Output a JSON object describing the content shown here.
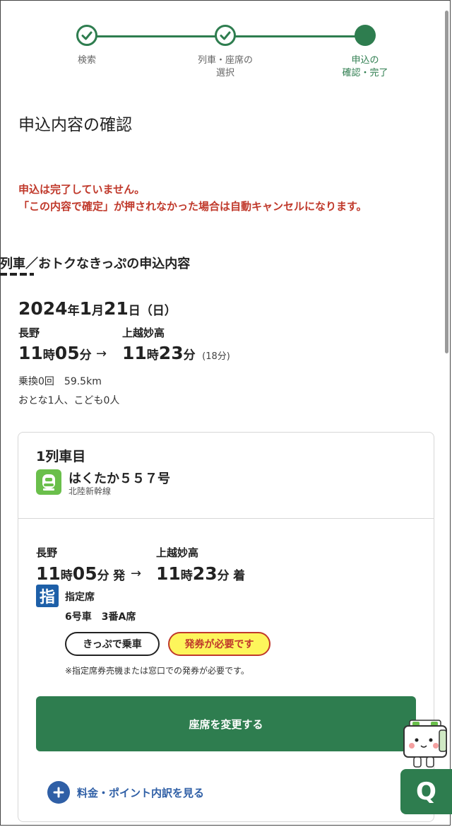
{
  "stepper": {
    "steps": [
      {
        "label_line1": "検索",
        "label_line2": "",
        "status": "done"
      },
      {
        "label_line1": "列車・座席の",
        "label_line2": "選択",
        "status": "done"
      },
      {
        "label_line1": "申込の",
        "label_line2": "確認・完了",
        "status": "current"
      }
    ],
    "accent_color": "#2e7d4f"
  },
  "page_title": "申込内容の確認",
  "warning": {
    "line1": "申込は完了していません。",
    "line2": "「この内容で確定」が押されなかった場合は自動キャンセルになります。",
    "color": "#c0392b"
  },
  "section_title": "列車／おトクなきっぷの申込内容",
  "trip": {
    "date": {
      "year": "2024",
      "year_unit": "年",
      "month": "1",
      "month_unit": "月",
      "day": "21",
      "day_unit": "日",
      "weekday": "（日）"
    },
    "from": "長野",
    "to": "上越妙高",
    "dep": {
      "hour": "11",
      "hour_unit": "時",
      "min": "05",
      "min_unit": "分"
    },
    "arr": {
      "hour": "11",
      "hour_unit": "時",
      "min": "23",
      "min_unit": "分"
    },
    "arrow": "→",
    "duration": "(18分)",
    "transfers": "乗換0回",
    "distance": "59.5km",
    "passengers": "おとな1人、こども0人"
  },
  "train_card": {
    "heading": "1列車目",
    "train_name": "はくたか５５７号",
    "line_name": "北陸新幹線",
    "from": "長野",
    "to": "上越妙高",
    "dep": {
      "hour": "11",
      "hour_unit": "時",
      "min": "05",
      "min_unit": "分",
      "suffix": "発"
    },
    "arr": {
      "hour": "11",
      "hour_unit": "時",
      "min": "23",
      "min_unit": "分",
      "suffix": "着"
    },
    "arrow": "→",
    "seat_badge": "指",
    "seat_type": "指定席",
    "car": "6号車",
    "seat": "3番A席",
    "ticket_pill": "きっぷで乗車",
    "issue_pill": "発券が必要です",
    "note": "※指定席券売機または窓口での発券が必要です。",
    "change_button": "座席を変更する",
    "fare_link": "料金・ポイント内訳を見る"
  },
  "fab": {
    "label": "Q"
  }
}
